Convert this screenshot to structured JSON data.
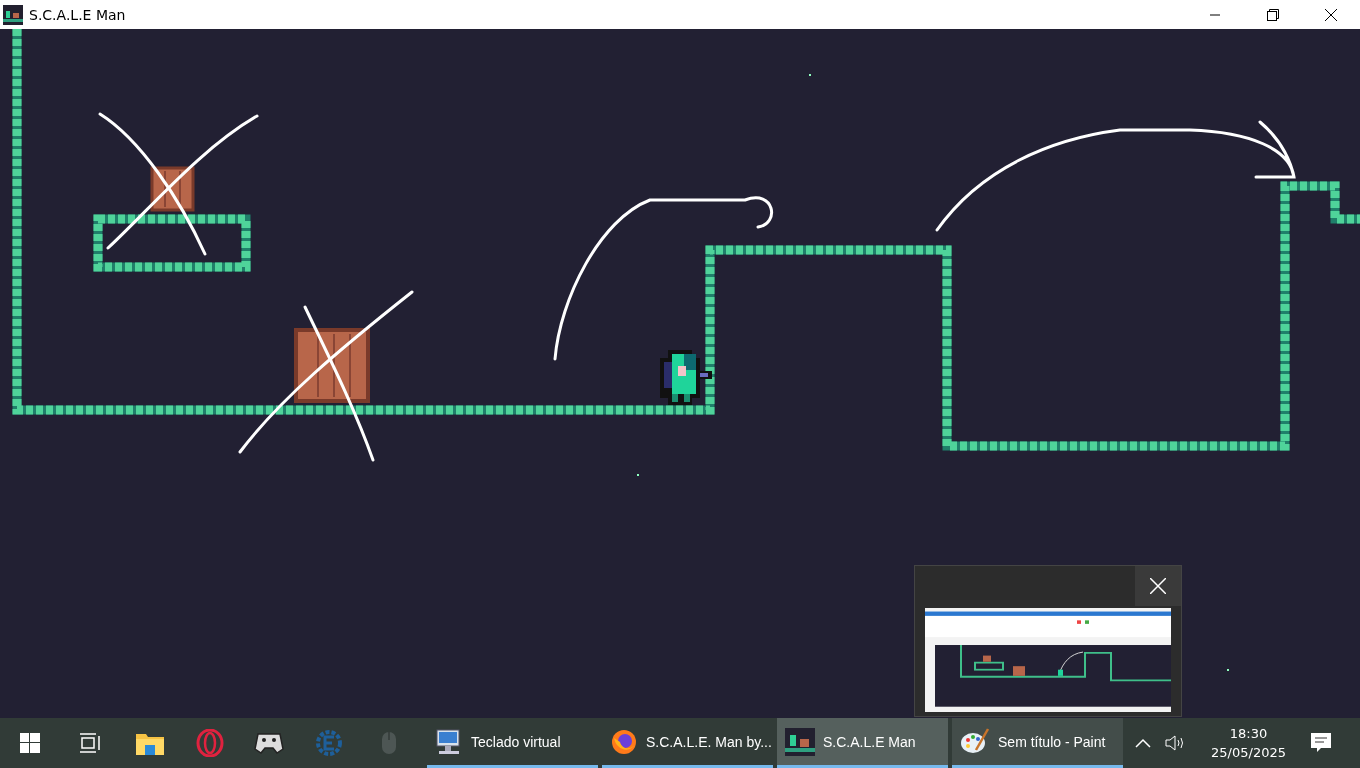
{
  "window": {
    "title": "S.C.A.L.E Man"
  },
  "taskbar": {
    "pinned": [
      {
        "kind": "start"
      },
      {
        "kind": "task-view"
      },
      {
        "kind": "folder"
      },
      {
        "kind": "opera"
      },
      {
        "kind": "gamepad"
      },
      {
        "kind": "engine"
      },
      {
        "kind": "mouse"
      }
    ],
    "tasks": [
      {
        "kind": "keyboard",
        "label": "Teclado virtual",
        "selected": false,
        "hovered": false
      },
      {
        "kind": "firefox",
        "label": "S.C.A.L.E. Man by...",
        "selected": false,
        "hovered": false
      },
      {
        "kind": "game",
        "label": "S.C.A.L.E Man",
        "selected": true,
        "hovered": false
      },
      {
        "kind": "paint",
        "label": "Sem título - Paint",
        "selected": false,
        "hovered": true
      }
    ],
    "tray": {
      "time": "18:30",
      "date": "25/05/2025"
    }
  }
}
